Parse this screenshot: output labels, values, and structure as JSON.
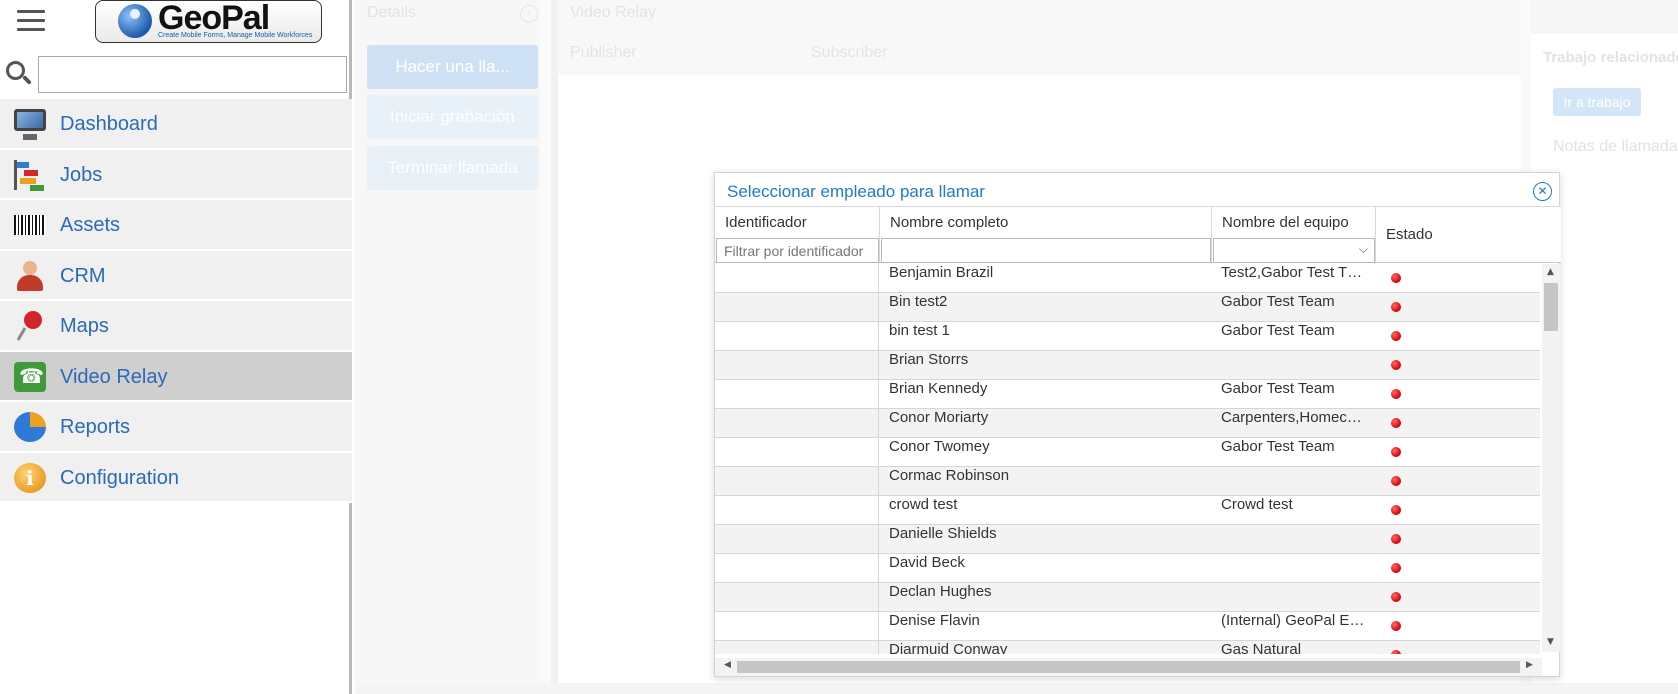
{
  "logo": {
    "name": "GeoPal",
    "tagline": "Create Mobile Forms, Manage Mobile Workforces"
  },
  "search": {
    "placeholder": "",
    "value": ""
  },
  "nav": [
    {
      "label": "Dashboard",
      "icon": "monitor-icon",
      "active": false
    },
    {
      "label": "Jobs",
      "icon": "gantt-chart-icon",
      "active": false
    },
    {
      "label": "Assets",
      "icon": "barcode-icon",
      "active": false
    },
    {
      "label": "CRM",
      "icon": "person-icon",
      "active": false
    },
    {
      "label": "Maps",
      "icon": "map-pin-icon",
      "active": false
    },
    {
      "label": "Video Relay",
      "icon": "video-phone-icon",
      "active": true
    },
    {
      "label": "Reports",
      "icon": "pie-chart-icon",
      "active": false
    },
    {
      "label": "Configuration",
      "icon": "info-icon",
      "active": false
    }
  ],
  "details": {
    "title": "Details",
    "buttons": {
      "call": "Hacer una lla...",
      "record": "Iniciar grabación",
      "end": "Terminar llamada"
    }
  },
  "video": {
    "title": "Video Relay",
    "publisher": "Publisher",
    "subscriber": "Subscriber"
  },
  "right_panel": {
    "related_title": "Trabajo relacionado",
    "go_button": "Ir a trabajo",
    "notes": "Notas de llamada"
  },
  "modal": {
    "title": "Seleccionar empleado para llamar",
    "columns": {
      "id": "Identificador",
      "name": "Nombre completo",
      "team": "Nombre del equipo",
      "state": "Estado"
    },
    "filter_id_placeholder": "Filtrar por identificador",
    "status_color": "#d40000",
    "rows": [
      {
        "id": "",
        "name": "Benjamin Brazil",
        "team": "Test2,Gabor Test T…",
        "status": "offline"
      },
      {
        "id": "",
        "name": "Bin test2",
        "team": "Gabor Test Team",
        "status": "offline"
      },
      {
        "id": "",
        "name": "bin test 1",
        "team": "Gabor Test Team",
        "status": "offline"
      },
      {
        "id": "",
        "name": "Brian Storrs",
        "team": "",
        "status": "offline"
      },
      {
        "id": "",
        "name": "Brian Kennedy",
        "team": "Gabor Test Team",
        "status": "offline"
      },
      {
        "id": "",
        "name": "Conor Moriarty",
        "team": "Carpenters,Homec…",
        "status": "offline"
      },
      {
        "id": "",
        "name": "Conor Twomey",
        "team": "Gabor Test Team",
        "status": "offline"
      },
      {
        "id": "",
        "name": "Cormac Robinson",
        "team": "",
        "status": "offline"
      },
      {
        "id": "",
        "name": "crowd test",
        "team": "Crowd test",
        "status": "offline"
      },
      {
        "id": "",
        "name": "Danielle Shields",
        "team": "",
        "status": "offline"
      },
      {
        "id": "",
        "name": "David Beck",
        "team": "",
        "status": "offline"
      },
      {
        "id": "",
        "name": "Declan Hughes",
        "team": "",
        "status": "offline"
      },
      {
        "id": "",
        "name": "Denise Flavin",
        "team": "(Internal) GeoPal E…",
        "status": "offline"
      },
      {
        "id": "",
        "name": "Diarmuid Conway",
        "team": "Gas Natural",
        "status": "offline"
      }
    ]
  }
}
